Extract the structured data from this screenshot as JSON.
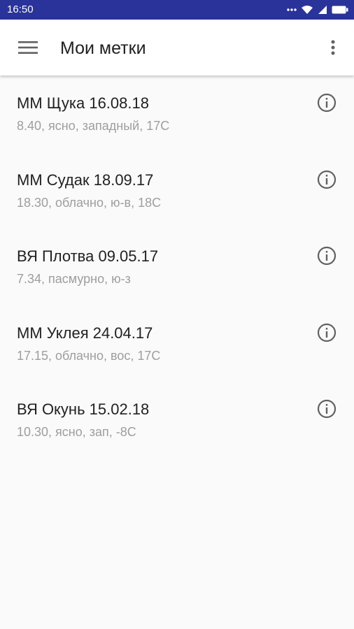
{
  "status_bar": {
    "time": "16:50",
    "icons": [
      "dots-icon",
      "wifi-icon",
      "signal-icon",
      "battery-icon"
    ]
  },
  "toolbar": {
    "title": "Мои метки",
    "menu_icon": "hamburger-menu-icon",
    "overflow_icon": "more-vertical-icon"
  },
  "marks": [
    {
      "title": "ММ Щука 16.08.18",
      "details": "8.40, ясно, западный, 17С"
    },
    {
      "title": "ММ Судак 18.09.17",
      "details": "18.30, облачно, ю-в, 18С"
    },
    {
      "title": "ВЯ Плотва 09.05.17",
      "details": "7.34, пасмурно, ю-з"
    },
    {
      "title": "ММ Уклея 24.04.17",
      "details": "17.15, облачно, вос, 17С"
    },
    {
      "title": "ВЯ Окунь 15.02.18",
      "details": "10.30, ясно, зап, -8С"
    }
  ],
  "colors": {
    "status_bar": "#2a3399",
    "toolbar": "#ffffff",
    "background": "#fafafa",
    "primary_text": "#212121",
    "secondary_text": "#9e9e9e",
    "icon": "#616161"
  }
}
